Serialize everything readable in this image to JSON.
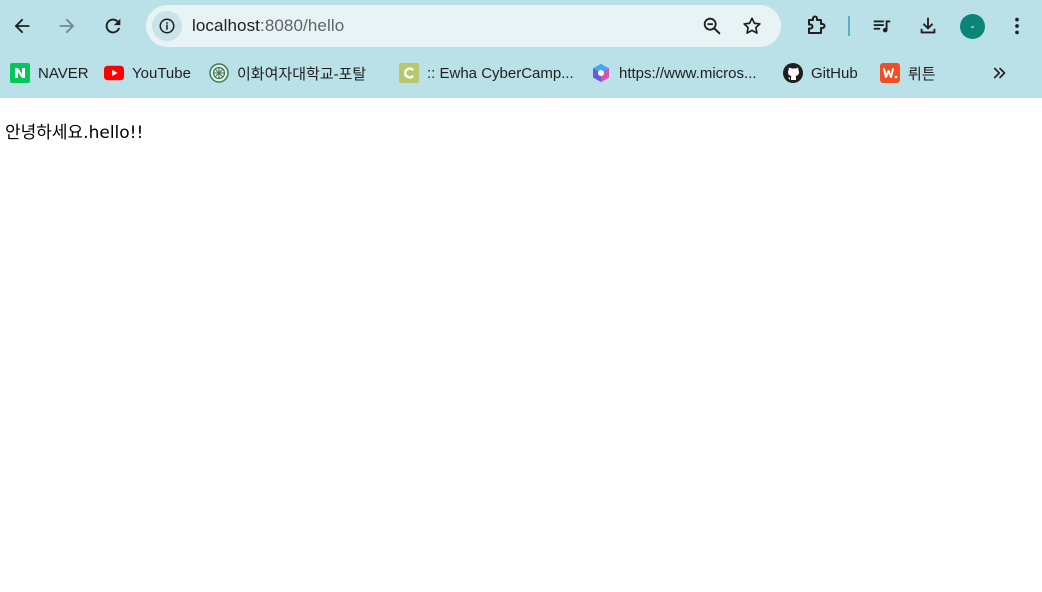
{
  "browser": {
    "address_bar": {
      "host": "localhost",
      "path": ":8080/hello"
    },
    "profile_initial": "-",
    "bookmarks": [
      {
        "label": "NAVER",
        "icon": "naver-icon"
      },
      {
        "label": "YouTube",
        "icon": "youtube-icon"
      },
      {
        "label": "이화여자대학교-포탈",
        "icon": "ewha-emblem-icon"
      },
      {
        "label": ":: Ewha CyberCamp...",
        "icon": "cybercampus-icon"
      },
      {
        "label": "https://www.micros...",
        "icon": "microsoft-copilot-icon"
      },
      {
        "label": "GitHub",
        "icon": "github-icon"
      },
      {
        "label": "뤼튼",
        "icon": "wrtn-icon"
      }
    ],
    "colors": {
      "chrome_background": "#b9e1e7",
      "omnibox_background": "#e7f3f4",
      "avatar": "#0b8577"
    }
  },
  "page": {
    "text": "안녕하세요.hello!!"
  }
}
